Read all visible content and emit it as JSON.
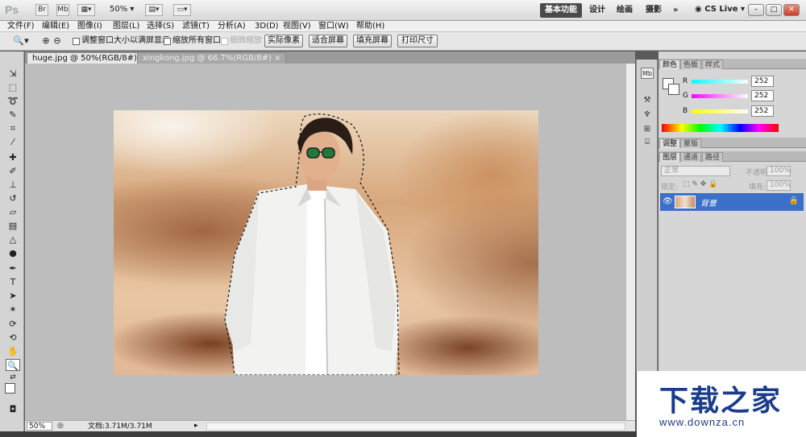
{
  "titlebar": {
    "logo": "Ps",
    "br_button": "Br",
    "mb_button": "Mb",
    "zoom": "50%",
    "workspaces": [
      "基本功能",
      "设计",
      "绘画",
      "摄影"
    ],
    "more": "»",
    "cs_live": "CS Live",
    "window_min": "–",
    "window_restore": "□",
    "window_close": "✕"
  },
  "menu": [
    "文件(F)",
    "编辑(E)",
    "图像(I)",
    "图层(L)",
    "选择(S)",
    "滤镜(T)",
    "分析(A)",
    "3D(D)",
    "视图(V)",
    "窗口(W)",
    "帮助(H)"
  ],
  "options": {
    "resize_windows": "调整窗口大小以满屏显示",
    "zoom_all_windows": "缩放所有窗口",
    "scrubby_zoom": "细微缩放",
    "actual_pixels": "实际像素",
    "fit_screen": "适合屏幕",
    "fill_screen": "填充屏幕",
    "print_size": "打印尺寸"
  },
  "tabs": [
    {
      "label": "huge.jpg @ 50%(RGB/8#) *",
      "close": "×"
    },
    {
      "label": "xingkong.jpg @ 66.7%(RGB/8#)",
      "close": "×"
    }
  ],
  "status": {
    "zoom": "50%",
    "doc": "文档:3.71M/3.71M"
  },
  "color_panel": {
    "tabs": [
      "颜色",
      "色板",
      "样式"
    ],
    "r_label": "R",
    "r_value": "252",
    "g_label": "G",
    "g_value": "252",
    "b_label": "B",
    "b_value": "252"
  },
  "adjust_panel": {
    "tabs": [
      "调整",
      "蒙版"
    ]
  },
  "layers_panel": {
    "tabs": [
      "图层",
      "通道",
      "路径"
    ],
    "blend_mode": "正常",
    "opacity_label": "不透明度:",
    "opacity_value": "100%",
    "lock_label": "锁定:",
    "fill_label": "填充:",
    "fill_value": "100%",
    "layer_name": "背景"
  },
  "watermark": {
    "main": "下载之家",
    "url": "www.downza.cn"
  },
  "colors": {
    "layer_selected": "#3b6fc8",
    "watermark": "#1a3c8c"
  }
}
